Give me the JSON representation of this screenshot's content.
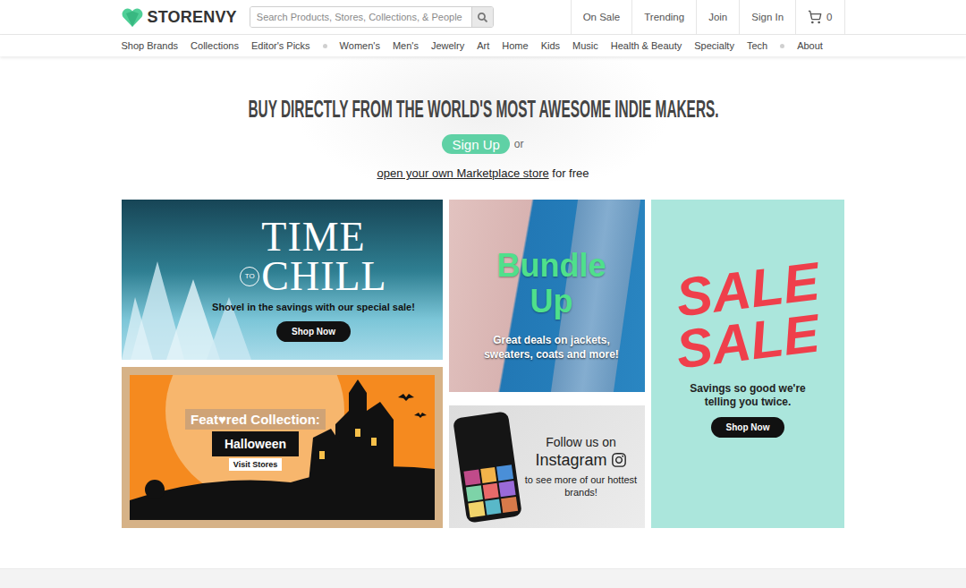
{
  "header": {
    "logo": "STORENVY",
    "search": {
      "placeholder": "Search Products, Stores, Collections, & People"
    },
    "nav": [
      {
        "label": "On Sale"
      },
      {
        "label": "Trending"
      },
      {
        "label": "Join"
      },
      {
        "label": "Sign In"
      }
    ],
    "cart": {
      "count": "0"
    }
  },
  "categories": [
    [
      "Shop Brands",
      "Collections",
      "Editor's Picks"
    ],
    [
      "Women's",
      "Men's",
      "Jewelry",
      "Art",
      "Home",
      "Kids",
      "Music",
      "Health & Beauty",
      "Specialty",
      "Tech"
    ],
    [
      "About"
    ]
  ],
  "hero": {
    "heading": "BUY DIRECTLY FROM THE WORLD'S MOST AWESOME INDIE MAKERS.",
    "signup": "Sign Up",
    "or": "or",
    "link": "open your own Marketplace store",
    "link_suffix": "for free"
  },
  "banners": {
    "winter": {
      "title": "TIME",
      "connector": "TO",
      "title2": "CHILL",
      "subtitle": "Shovel in the savings with our special sale!",
      "button": "Shop Now"
    },
    "bundle": {
      "lines": [
        "Bundle",
        "Up"
      ],
      "subtitle": "Great deals on jackets, sweaters, coats and more!"
    },
    "sale": {
      "lines": [
        "SALE",
        "SALE"
      ],
      "subtitle": "Savings so good we're telling you twice.",
      "button": "Shop Now"
    },
    "halloween": {
      "label": "Feat♥red Collection:",
      "title": "Halloween",
      "button": "Visit Stores"
    },
    "instagram": {
      "lead": "Follow us on",
      "name": "Instagram",
      "subtitle": "to see more of our hottest brands!"
    }
  }
}
